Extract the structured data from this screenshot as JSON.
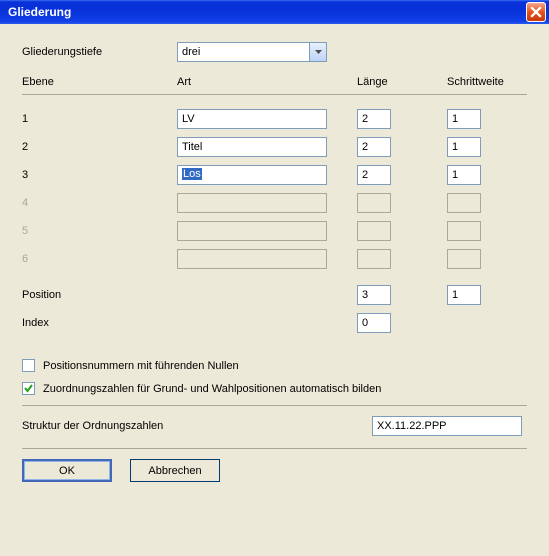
{
  "window": {
    "title": "Gliederung"
  },
  "depth": {
    "label": "Gliederungstiefe",
    "value": "drei"
  },
  "headers": {
    "ebene": "Ebene",
    "art": "Art",
    "laenge": "Länge",
    "schrittweite": "Schrittweite"
  },
  "levels": [
    {
      "num": "1",
      "art": "LV",
      "len": "2",
      "step": "1",
      "enabled": true,
      "selected": false
    },
    {
      "num": "2",
      "art": "Titel",
      "len": "2",
      "step": "1",
      "enabled": true,
      "selected": false
    },
    {
      "num": "3",
      "art": "Los",
      "len": "2",
      "step": "1",
      "enabled": true,
      "selected": true
    },
    {
      "num": "4",
      "art": "",
      "len": "",
      "step": "",
      "enabled": false,
      "selected": false
    },
    {
      "num": "5",
      "art": "",
      "len": "",
      "step": "",
      "enabled": false,
      "selected": false
    },
    {
      "num": "6",
      "art": "",
      "len": "",
      "step": "",
      "enabled": false,
      "selected": false
    }
  ],
  "position": {
    "label": "Position",
    "len": "3",
    "step": "1"
  },
  "index": {
    "label": "Index",
    "value": "0"
  },
  "checkboxes": {
    "leadingZeros": {
      "label": "Positionsnummern mit führenden Nullen",
      "checked": false
    },
    "autoOrdinals": {
      "label": "Zuordnungszahlen für Grund- und Wahlpositionen automatisch bilden",
      "checked": true
    }
  },
  "structure": {
    "label": "Struktur der Ordnungszahlen",
    "value": "XX.11.22.PPP"
  },
  "buttons": {
    "ok": "OK",
    "cancel": "Abbrechen"
  }
}
